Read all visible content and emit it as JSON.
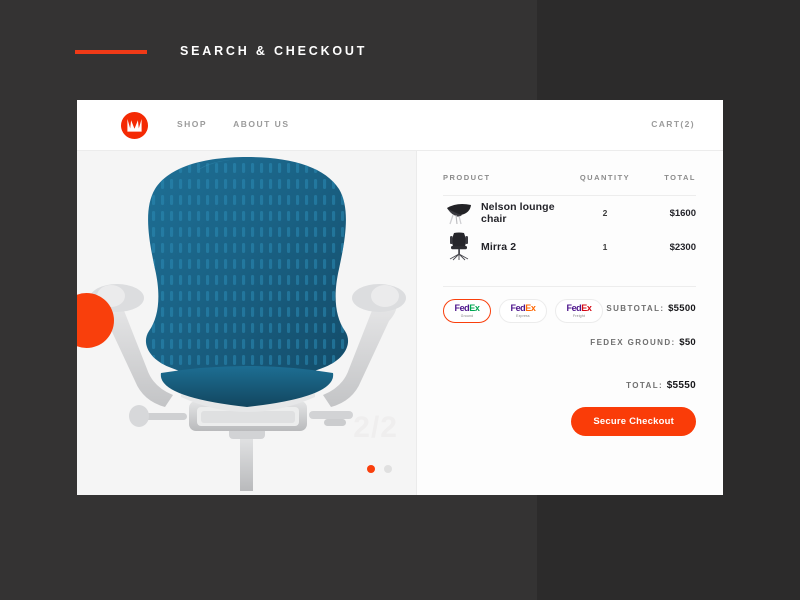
{
  "banner": {
    "title": "SEARCH & CHECKOUT",
    "rule_color": "#f03a17"
  },
  "nav": {
    "logo_name": "herman-miller-logo",
    "links": [
      {
        "label": "SHOP"
      },
      {
        "label": "ABOUT US"
      }
    ],
    "cart_label": "CART(2)"
  },
  "gallery": {
    "product_image_name": "mirra-2-chair-photo",
    "slide_counter": "2/2",
    "dots": [
      {
        "active": true
      },
      {
        "active": false
      }
    ],
    "accent_circle_color": "#f93f0c"
  },
  "cart": {
    "columns": {
      "product": "PRODUCT",
      "quantity": "QUANTITY",
      "total": "TOTAL"
    },
    "items": [
      {
        "thumb": "nelson-lounge-chair-thumb",
        "name": "Nelson lounge chair",
        "quantity": "2",
        "total": "$1600"
      },
      {
        "thumb": "mirra-2-chair-thumb",
        "name": "Mirra 2",
        "quantity": "1",
        "total": "$2300"
      }
    ],
    "summary": {
      "subtotal_label": "SUBTOTAL:",
      "subtotal_value": "$5500",
      "shipping_label": "FEDEX GROUND:",
      "shipping_value": "$50",
      "total_label": "TOTAL:",
      "total_value": "$5550"
    },
    "shipping_options": [
      {
        "brand": "Fed",
        "service_mark": "Ex",
        "sub": "Ground",
        "selected": true
      },
      {
        "brand": "Fed",
        "service_mark": "Ex",
        "sub": "Express",
        "selected": false
      },
      {
        "brand": "Fed",
        "service_mark": "Ex",
        "sub": "Freight",
        "selected": false
      }
    ],
    "checkout_label": "Secure Checkout",
    "checkout_color": "#fa3c08"
  }
}
